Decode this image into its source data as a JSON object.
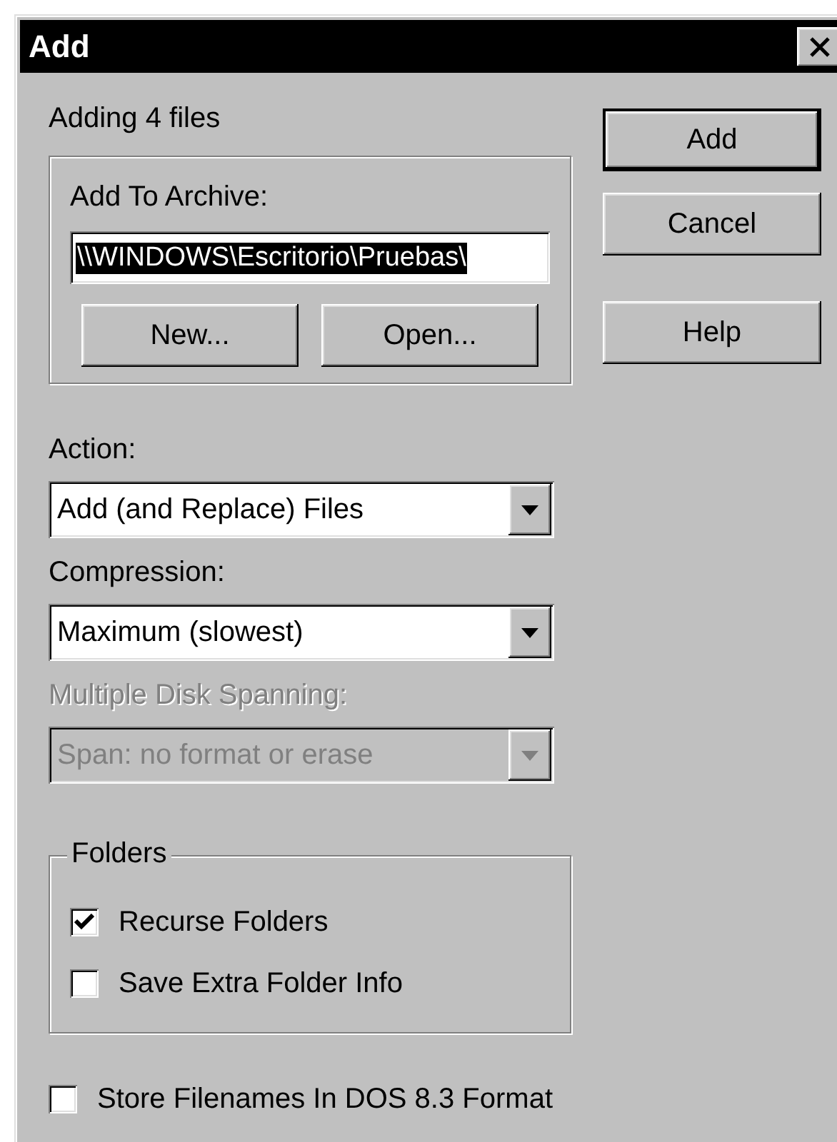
{
  "window": {
    "title": "Add"
  },
  "summary": "Adding 4 files",
  "archive_group": {
    "label": "Add To Archive:",
    "path": "\\\\WINDOWS\\Escritorio\\Pruebas\\",
    "text_selected": true,
    "buttons": [
      "New...",
      "Open..."
    ]
  },
  "buttons": [
    {
      "label": "Add",
      "default": true
    },
    {
      "label": "Cancel",
      "default": false
    },
    {
      "label": "Help",
      "default": false
    }
  ],
  "dropdowns": [
    {
      "label": "Action:",
      "value": "Add (and Replace) Files",
      "disabled": false
    },
    {
      "label": "Compression:",
      "value": "Maximum (slowest)",
      "disabled": false
    },
    {
      "label": "Multiple Disk Spanning:",
      "value": "Span: no format or erase",
      "disabled": true
    }
  ],
  "folders_group": {
    "title": "Folders",
    "options": [
      {
        "label": "Recurse Folders",
        "checked": true
      },
      {
        "label": "Save Extra Folder Info",
        "checked": false
      }
    ]
  },
  "dos_option": {
    "label": "Store Filenames In DOS 8.3 Format",
    "checked": false
  }
}
